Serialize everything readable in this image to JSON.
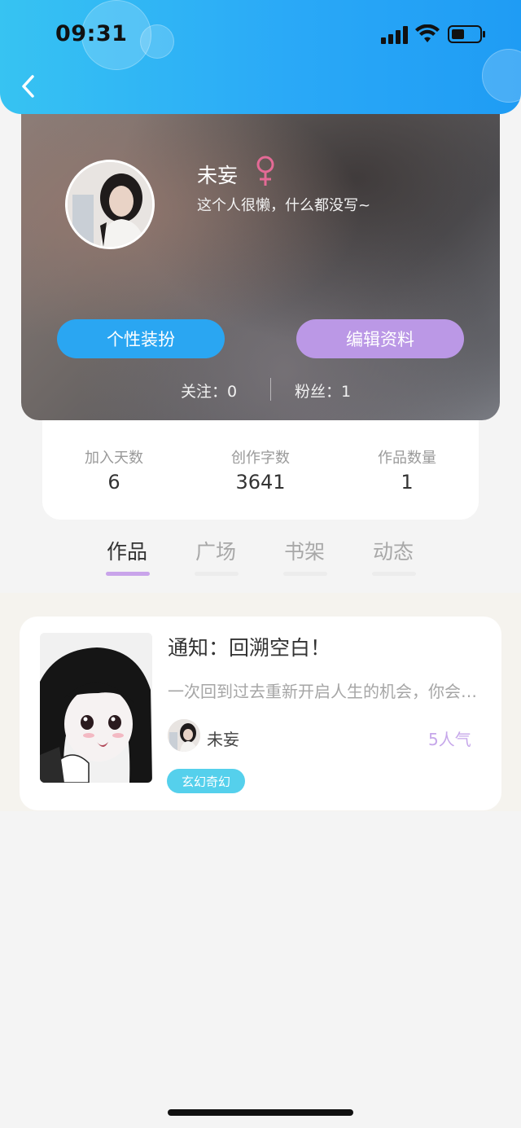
{
  "status_bar": {
    "time": "09:31"
  },
  "profile": {
    "name": "未妄",
    "bio": "这个人很懒，什么都没写~",
    "gender_symbol": "♀",
    "buttons": {
      "dress_up": "个性装扮",
      "edit_profile": "编辑资料"
    },
    "follow_text": "关注：0",
    "fans_text": "粉丝：1"
  },
  "stats": [
    {
      "label": "加入天数",
      "value": "6"
    },
    {
      "label": "创作字数",
      "value": "3641"
    },
    {
      "label": "作品数量",
      "value": "1"
    }
  ],
  "tabs": [
    {
      "label": "作品",
      "active": true
    },
    {
      "label": "广场",
      "active": false
    },
    {
      "label": "书架",
      "active": false
    },
    {
      "label": "动态",
      "active": false
    }
  ],
  "works": [
    {
      "title": "通知：回溯空白！",
      "description": "一次回到过去重新开启人生的机会，你会怎么选择",
      "author": "未妄",
      "popularity": "5人气",
      "tag": "玄幻奇幻"
    }
  ],
  "colors": {
    "header_gradient_start": "#37c3f2",
    "header_gradient_end": "#1f9cf4",
    "primary_blue": "#2aa6f2",
    "purple": "#bb98e6",
    "female_pink": "#e46a96",
    "tag_cyan": "#55d0ec",
    "popularity_purple": "#c6a7ea"
  }
}
